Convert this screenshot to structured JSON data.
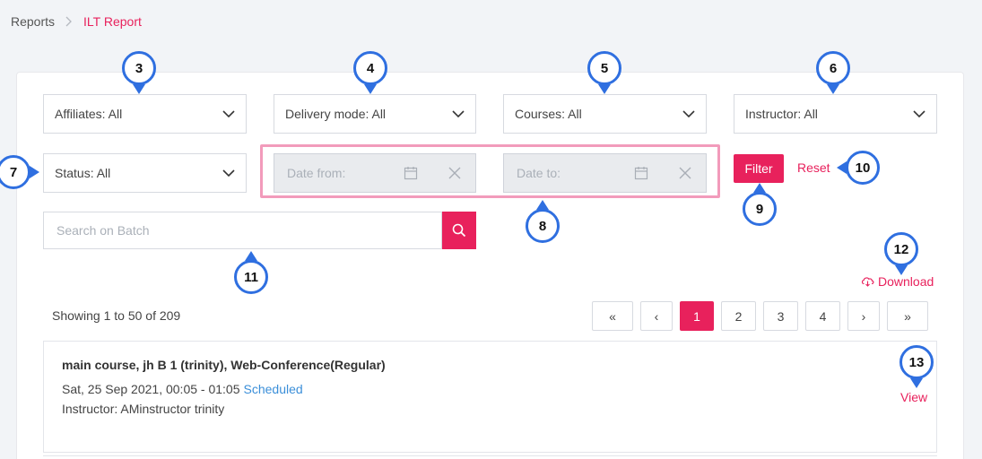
{
  "breadcrumb": {
    "root": "Reports",
    "current": "ILT Report"
  },
  "filters": {
    "affiliates": "Affiliates: All",
    "delivery_mode": "Delivery mode: All",
    "courses": "Courses: All",
    "instructor": "Instructor: All",
    "status": "Status: All",
    "date_from": "Date from:",
    "date_to": "Date to:",
    "filter_label": "Filter",
    "reset_label": "Reset"
  },
  "search": {
    "placeholder": "Search on Batch"
  },
  "download_label": "Download",
  "showing": "Showing 1 to 50 of 209",
  "pagination": {
    "first": "«",
    "prev": "‹",
    "pages": [
      "1",
      "2",
      "3",
      "4"
    ],
    "next": "›",
    "last": "»",
    "active": "1"
  },
  "result": {
    "title": "main course, jh B 1 (trinity), Web-Conference(Regular)",
    "datetime": "Sat, 25 Sep 2021, 00:05 - 01:05",
    "status": "Scheduled",
    "instructor": "Instructor: AMinstructor trinity",
    "view_label": "View"
  },
  "markers": [
    "3",
    "4",
    "5",
    "6",
    "7",
    "8",
    "9",
    "10",
    "11",
    "12",
    "13"
  ],
  "colors": {
    "accent": "#e8215c",
    "marker": "#2f6fe0",
    "highlight": "#f29bbb",
    "status": "#3b8fd9"
  }
}
